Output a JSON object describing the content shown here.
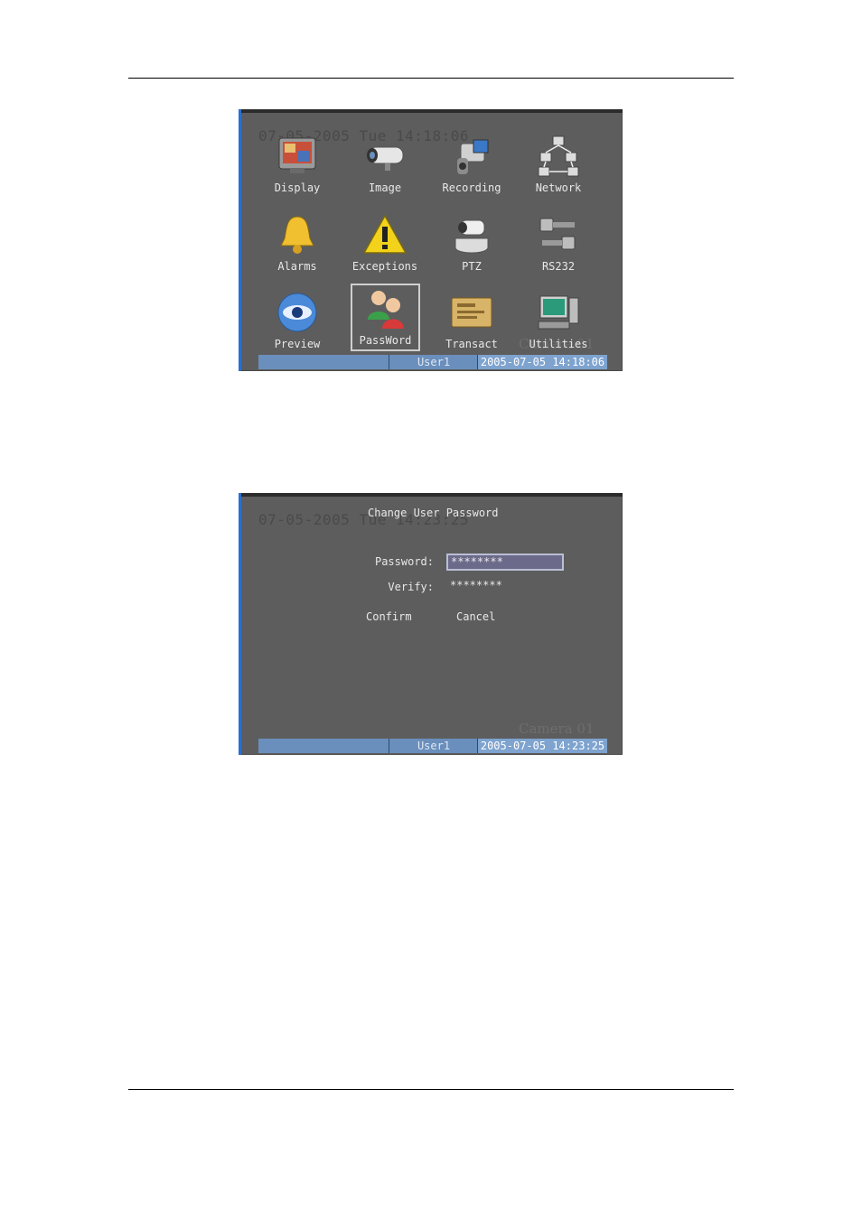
{
  "colors": {
    "screen_bg": "#5d5d5d",
    "accent_blue": "#2a6fd0",
    "status_bar": "#6a8fbc"
  },
  "main_menu": {
    "osd_datetime": "07-05-2005 Tue 14:18:06",
    "camera_overlay": "Camera 01",
    "items": [
      {
        "label": "Display",
        "icon": "display-icon"
      },
      {
        "label": "Image",
        "icon": "camera-icon"
      },
      {
        "label": "Recording",
        "icon": "camcorder-icon"
      },
      {
        "label": "Network",
        "icon": "network-icon"
      },
      {
        "label": "Alarms",
        "icon": "bell-icon"
      },
      {
        "label": "Exceptions",
        "icon": "warning-icon"
      },
      {
        "label": "PTZ",
        "icon": "ptz-camera-icon"
      },
      {
        "label": "RS232",
        "icon": "serial-connector-icon"
      },
      {
        "label": "Preview",
        "icon": "eye-icon"
      },
      {
        "label": "PassWord",
        "icon": "users-icon",
        "selected": true
      },
      {
        "label": "Transact",
        "icon": "card-icon"
      },
      {
        "label": "Utilities",
        "icon": "computer-icon"
      }
    ],
    "status": {
      "user": "User1",
      "datetime": "2005-07-05 14:18:06"
    }
  },
  "password_dialog": {
    "osd_datetime": "07-05-2005 Tue 14:23:25",
    "title": "Change User Password",
    "camera_overlay": "Camera 01",
    "password_label": "Password:",
    "password_value": "********",
    "verify_label": "Verify:",
    "verify_value": "********",
    "confirm_label": "Confirm",
    "cancel_label": "Cancel",
    "status": {
      "user": "User1",
      "datetime": "2005-07-05 14:23:25"
    }
  }
}
